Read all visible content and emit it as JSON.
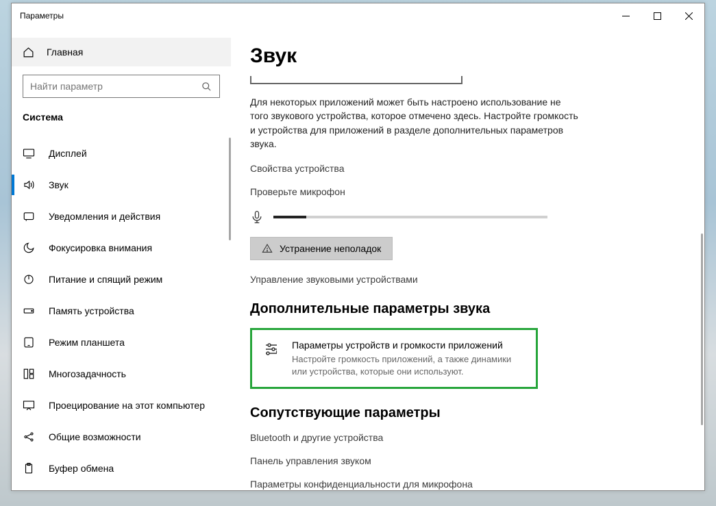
{
  "window": {
    "title": "Параметры"
  },
  "sidebar": {
    "home": "Главная",
    "search_placeholder": "Найти параметр",
    "section": "Система",
    "items": [
      {
        "label": "Дисплей"
      },
      {
        "label": "Звук"
      },
      {
        "label": "Уведомления и действия"
      },
      {
        "label": "Фокусировка внимания"
      },
      {
        "label": "Питание и спящий режим"
      },
      {
        "label": "Память устройства"
      },
      {
        "label": "Режим планшета"
      },
      {
        "label": "Многозадачность"
      },
      {
        "label": "Проецирование на этот компьютер"
      },
      {
        "label": "Общие возможности"
      },
      {
        "label": "Буфер обмена"
      }
    ]
  },
  "main": {
    "heading": "Звук",
    "desc": "Для некоторых приложений может быть настроено использование не того звукового устройства, которое отмечено здесь. Настройте громкость и устройства для приложений в разделе дополнительных параметров звука.",
    "device_props": "Свойства устройства",
    "test_mic": "Проверьте микрофон",
    "troubleshoot": "Устранение неполадок",
    "manage_devices": "Управление звуковыми устройствами",
    "advanced_heading": "Дополнительные параметры звука",
    "card": {
      "title": "Параметры устройств и громкости приложений",
      "desc": "Настройте громкость приложений, а также динамики или устройства, которые они используют."
    },
    "related_heading": "Сопутствующие параметры",
    "related": [
      "Bluetooth и другие устройства",
      "Панель управления звуком",
      "Параметры конфиденциальности для микрофона"
    ]
  }
}
